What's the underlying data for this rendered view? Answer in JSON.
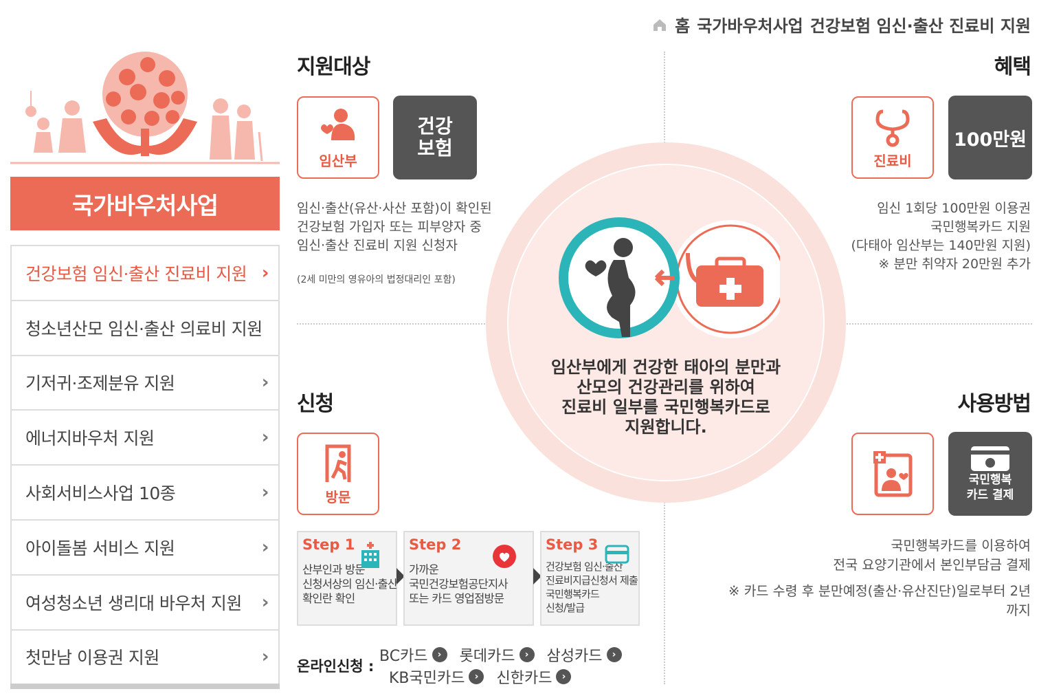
{
  "breadcrumb": {
    "items": [
      "홈",
      "국가바우처사업",
      "건강보험 임신·출산 진료비 지원"
    ]
  },
  "sidebar": {
    "title": "국가바우처사업",
    "items": [
      {
        "label": "건강보험 임신·출산 진료비 지원",
        "active": true
      },
      {
        "label": "청소년산모 임신·출산 의료비 지원",
        "active": false
      },
      {
        "label": "기저귀·조제분유 지원",
        "active": false
      },
      {
        "label": "에너지바우처 지원",
        "active": false
      },
      {
        "label": "사회서비스사업 10종",
        "active": false
      },
      {
        "label": "아이돌봄 서비스 지원",
        "active": false
      },
      {
        "label": "여성청소년 생리대 바우처 지원",
        "active": false
      },
      {
        "label": "첫만남 이용권 지원",
        "active": false
      }
    ]
  },
  "target": {
    "title": "지원대상",
    "icon_label": "임산부",
    "box_text": "건강\n보험",
    "lines": [
      "임신·출산(유산·사산 포함)이 확인된",
      "건강보험 가입자 또는 피부양자 중",
      "임신·출산 진료비 지원 신청자"
    ],
    "note": "(2세 미만의 영유아의 법정대리인 포함)"
  },
  "benefit": {
    "title": "혜택",
    "icon_label": "진료비",
    "box_text": "100만원",
    "lines": [
      "임신 1회당 100만원 이용권",
      "국민행복카드 지원",
      "(다태아 임산부는 140만원 지원)",
      "※ 분만 취약자 20만원 추가"
    ]
  },
  "center": {
    "lines": [
      "임산부에게 건강한 태아의 분만과",
      "산모의 건강관리를 위하여",
      "진료비 일부를 국민행복카드로",
      "지원합니다."
    ]
  },
  "apply": {
    "title": "신청",
    "icon_label": "방문",
    "steps": [
      {
        "label": "Step 1",
        "lines": [
          "산부인과 방문",
          "신청서상의 임신·출산",
          "확인란 확인"
        ]
      },
      {
        "label": "Step 2",
        "lines": [
          "가까운",
          "국민건강보험공단지사",
          "또는 카드 영업점방문"
        ]
      },
      {
        "label": "Step 3",
        "lines": [
          "건강보험 임신·출산",
          "진료비지급신청서 제출",
          "국민행복카드",
          "신청/발급"
        ]
      }
    ],
    "online_label": "온라인신청 :",
    "cards_row1": [
      "BC카드",
      "롯데카드",
      "삼성카드"
    ],
    "cards_row2": [
      "KB국민카드",
      "신한카드"
    ]
  },
  "usage": {
    "title": "사용방법",
    "box_text": "국민행복\n카드 결제",
    "lines": [
      "국민행복카드를 이용하여",
      "전국 요양기관에서 본인부담금 결제",
      "※ 카드 수령 후 분만예정(출산·유산진단)일로부터 2년",
      "까지"
    ]
  },
  "colors": {
    "accent": "#ec6b56",
    "dark": "#555555",
    "teal": "#2bb5b8"
  }
}
